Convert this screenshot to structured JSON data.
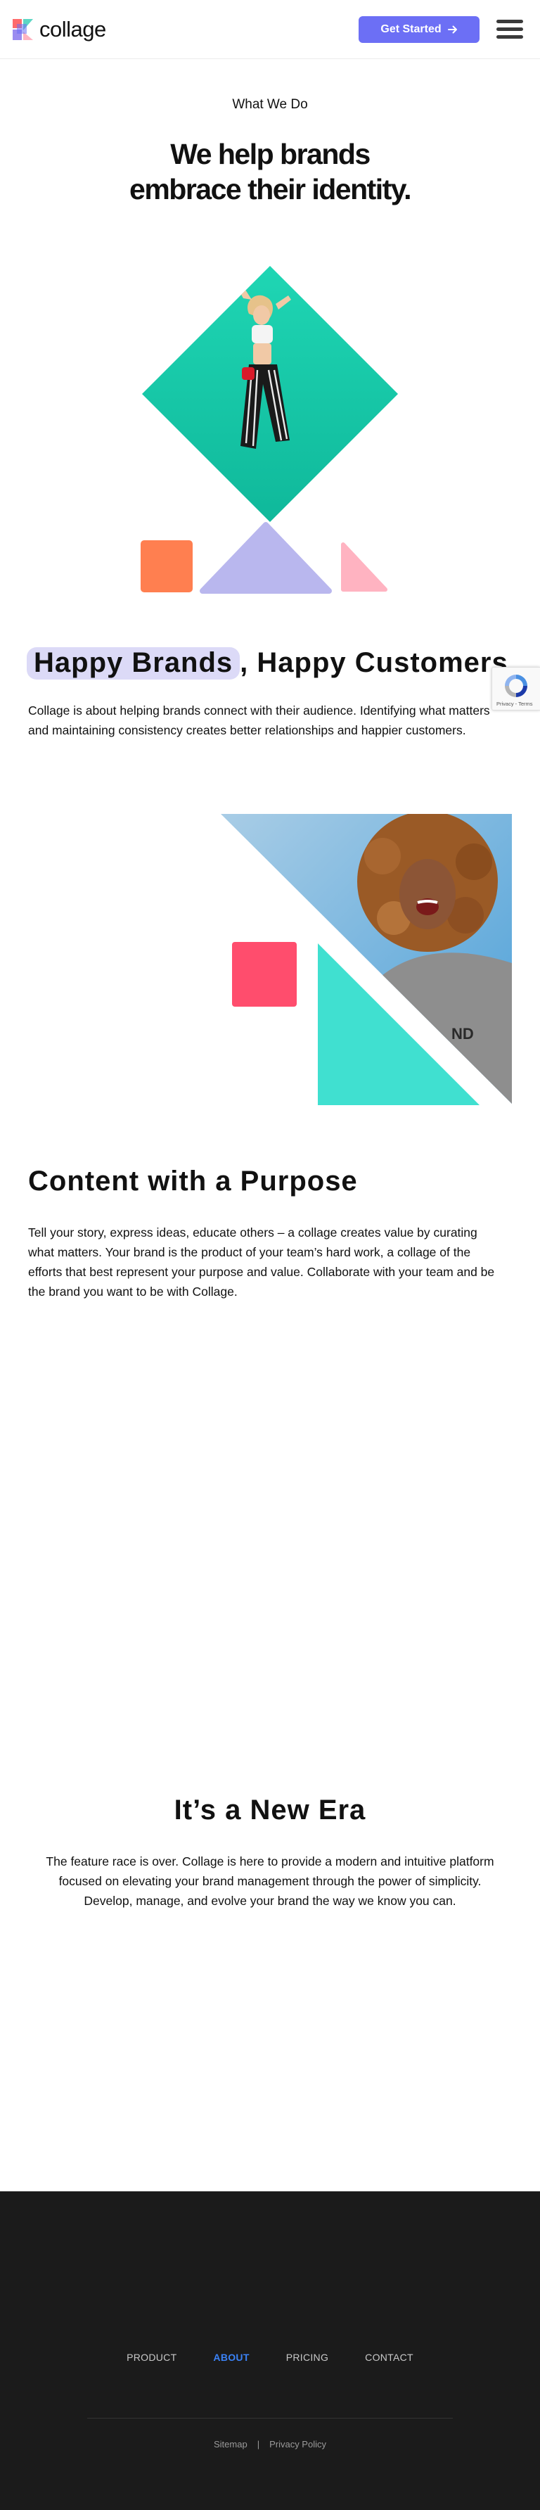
{
  "header": {
    "brand": "collage",
    "cta_label": "Get Started",
    "cta_icon": "arrow-right-icon",
    "menu_icon": "hamburger-menu-icon",
    "accent_color": "#6c6ff5"
  },
  "intro": {
    "eyebrow": "What We Do",
    "title_line1": "We help brands",
    "title_line2": "embrace their identity."
  },
  "happy": {
    "highlight": "Happy Brands",
    "rest": ", Happy Customers",
    "body": "Collage is about helping brands connect with their audience. Identifying what matters and maintaining consistency creates better relationships and happier customers."
  },
  "purpose": {
    "title": "Content with a Purpose",
    "body": "Tell your story, express ideas, educate others – a collage creates value by curating what matters. Your brand is the product of your team’s hard work, a collage of the efforts that best represent your purpose and value. Collaborate with your team and be the brand you want to be with Collage."
  },
  "era": {
    "title": "It’s a New Era",
    "body": "The feature race is over. Collage is here to provide a modern and intuitive platform focused on elevating your brand management through the power of simplicity. Develop, manage, and evolve your brand the way we know you can."
  },
  "recaptcha": {
    "links": "Privacy - Terms"
  },
  "footer": {
    "nav": [
      {
        "label": "PRODUCT",
        "active": false
      },
      {
        "label": "ABOUT",
        "active": true
      },
      {
        "label": "PRICING",
        "active": false
      },
      {
        "label": "CONTACT",
        "active": false
      }
    ],
    "sitemap": "Sitemap",
    "separator": "|",
    "privacy": "Privacy Policy",
    "active_color": "#3b82f6"
  },
  "colors": {
    "teal": "#16c9a7",
    "orange": "#ff7f50",
    "lavender": "#b9b7ee",
    "pink": "#ffb3c1",
    "coral": "#ff4d6d",
    "mint": "#40e0d0",
    "footer_bg": "#1b1b1b"
  }
}
